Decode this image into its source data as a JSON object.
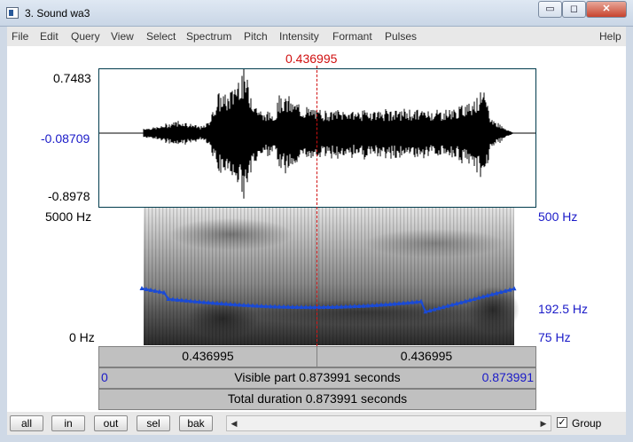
{
  "window": {
    "title": "3. Sound wa3",
    "min": "▭",
    "max": "◻",
    "close": "✕"
  },
  "menu": [
    "File",
    "Edit",
    "Query",
    "View",
    "Select",
    "Spectrum",
    "Pitch",
    "Intensity",
    "Formant",
    "Pulses"
  ],
  "help": "Help",
  "cursor_time": "0.436995",
  "wave_axis": {
    "max": "0.7483",
    "zero": "-0.08709",
    "min": "-0.8978"
  },
  "spec_axis": {
    "top": "5000 Hz",
    "bottom": "0 Hz"
  },
  "pitch_axis": {
    "top": "500 Hz",
    "mid": "192.5 Hz",
    "bottom": "75 Hz"
  },
  "time_bar": {
    "left": "0.436995",
    "right": "0.436995"
  },
  "visible_bar": {
    "start": "0",
    "label": "Visible part 0.873991 seconds",
    "end": "0.873991"
  },
  "total_bar": {
    "label": "Total duration 0.873991 seconds"
  },
  "buttons": [
    "all",
    "in",
    "out",
    "sel",
    "bak"
  ],
  "scroll": {
    "left": "◀",
    "right": "▶"
  },
  "group": {
    "checked": "✓",
    "label": "Group"
  },
  "colors": {
    "cursor": "#d01010",
    "pitch": "#1a4ad6",
    "axis_blue": "#1a1ac8"
  }
}
